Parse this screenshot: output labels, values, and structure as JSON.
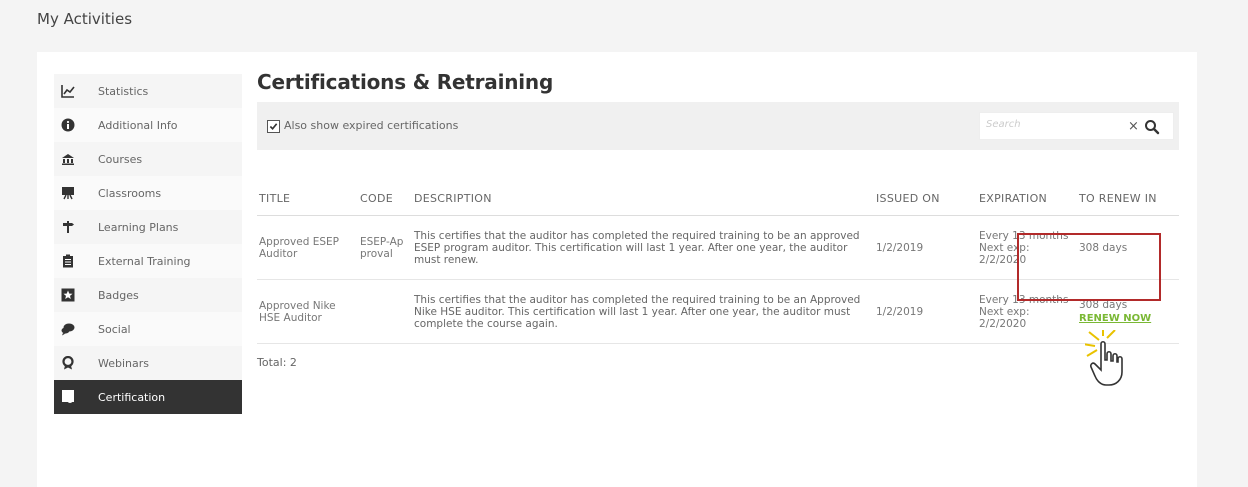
{
  "page": {
    "title": "My Activities"
  },
  "sidebar": {
    "items": [
      {
        "label": "Statistics",
        "icon": "chart-icon"
      },
      {
        "label": "Additional Info",
        "icon": "info-icon"
      },
      {
        "label": "Courses",
        "icon": "courses-icon"
      },
      {
        "label": "Classrooms",
        "icon": "classroom-icon"
      },
      {
        "label": "Learning Plans",
        "icon": "signpost-icon"
      },
      {
        "label": "External Training",
        "icon": "clipboard-icon"
      },
      {
        "label": "Badges",
        "icon": "star-icon"
      },
      {
        "label": "Social",
        "icon": "social-icon"
      },
      {
        "label": "Webinars",
        "icon": "webinar-icon"
      },
      {
        "label": "Certification",
        "icon": "certificate-icon",
        "active": true
      }
    ]
  },
  "main": {
    "title": "Certifications & Retraining",
    "filter": {
      "checkbox_label": "Also show expired certifications",
      "checked": true
    },
    "search": {
      "placeholder": "Search"
    },
    "table": {
      "headers": [
        "TITLE",
        "CODE",
        "DESCRIPTION",
        "ISSUED ON",
        "EXPIRATION",
        "TO RENEW IN"
      ],
      "rows": [
        {
          "title": "Approved ESEP Auditor",
          "code": "ESEP-Approval",
          "description": "This certifies that the auditor has completed the required training to be an approved ESEP program auditor. This certification will last 1 year.  After one year, the auditor must renew.",
          "issued_on": "1/2/2019",
          "expiration_line1": "Every 13 months",
          "expiration_line2": "Next exp:",
          "expiration_line3": "2/2/2020",
          "renew_in": "308 days",
          "renew_link": ""
        },
        {
          "title": "Approved Nike HSE Auditor",
          "code": "",
          "description": "This certifies that the auditor has completed the required training to be an Approved Nike HSE auditor. This certification will last 1 year.  After one year, the auditor must complete the course again.",
          "issued_on": "1/2/2019",
          "expiration_line1": "Every 13 months",
          "expiration_line2": "Next exp:",
          "expiration_line3": "2/2/2020",
          "renew_in": "308 days",
          "renew_link": "RENEW NOW"
        }
      ]
    },
    "total": "Total: 2"
  },
  "colors": {
    "accent_green": "#7ab834",
    "highlight_red": "#b22a2a",
    "active_bg": "#333333"
  }
}
